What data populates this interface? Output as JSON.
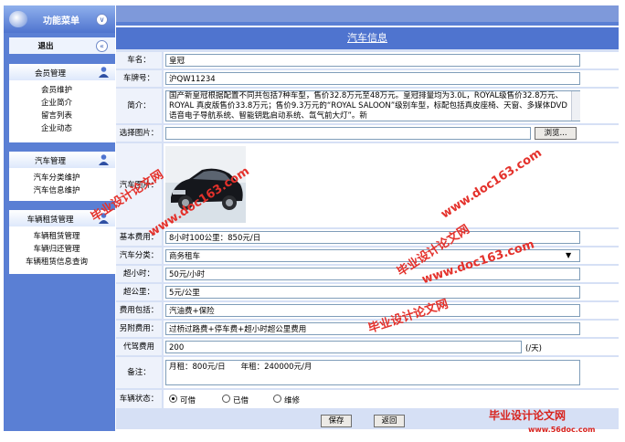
{
  "sidebar": {
    "title": "功能菜单",
    "logout": "退出",
    "groups": [
      {
        "title": "会员管理",
        "items": [
          "会员维护",
          "企业简介",
          "留言列表",
          "企业动态"
        ]
      },
      {
        "title": "汽车管理",
        "items": [
          "汽车分类维护",
          "汽车信息维护"
        ]
      },
      {
        "title": "车辆租赁管理",
        "items": [
          "车辆租赁管理",
          "车辆归还管理",
          "车辆租赁信息查询"
        ]
      }
    ]
  },
  "form": {
    "title": "汽车信息",
    "fields": {
      "name": {
        "label": "车名：",
        "value": "皇冠"
      },
      "plate": {
        "label": "车牌号：",
        "value": "沪QW11234"
      },
      "intro": {
        "label": "简介：",
        "value": "国产新皇冠根据配置不同共包括7种车型，售价32.8万元至48万元。皇冠排量均为3.0L，ROYAL级售价32.8万元、ROYAL 真皮版售价33.8万元；售价9.3万元的“ROYAL SALOON”级别车型，标配包括真皮座椅、天窗、多媒体DVD语音电子导航系统、智能钥匙启动系统、氙气前大灯”。新"
      },
      "image": {
        "label": "选择图片：",
        "browse": "浏览..."
      },
      "photo": {
        "label": "汽车图片："
      },
      "base_fee": {
        "label": "基本费用：",
        "value": "8小时100公里：850元/日"
      },
      "category": {
        "label": "汽车分类：",
        "value": "商务租车"
      },
      "overtime": {
        "label": "超小时：",
        "value": "50元/小时"
      },
      "overkm": {
        "label": "超公里：",
        "value": "5元/公里"
      },
      "includes": {
        "label": "费用包括：",
        "value": "汽油费+保险"
      },
      "extra": {
        "label": "另附费用：",
        "value": "过桥过路费+停车费+超小时超公里费用"
      },
      "driver": {
        "label": "代驾费用",
        "value": "200",
        "unit": "(/天)"
      },
      "remark": {
        "label": "备注：",
        "value": "月租：800元/日　　年租：240000元/月"
      },
      "status": {
        "label": "车辆状态：",
        "options": [
          "可借",
          "已借",
          "维修"
        ],
        "selected": "可借"
      }
    },
    "save": "保存",
    "back": "返回"
  },
  "watermarks": {
    "text1": "毕业设计论文网",
    "url1": "www.doc163.com",
    "text2": "毕业设计论文网",
    "url2": "www.doc163.com",
    "text3": "毕业设计论文网",
    "url3": "www.doc163.com",
    "corner": "毕业设计论文网",
    "corner_url": "www.56doc.com"
  }
}
